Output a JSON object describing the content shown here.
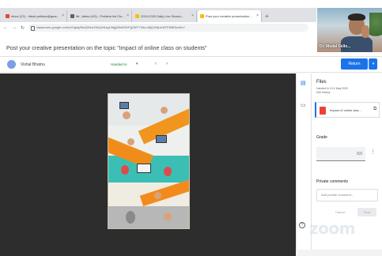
{
  "browser": {
    "tabs": [
      {
        "label": "Inbox (22) - ritesh.pethkar@gma...",
        "color": "#ea4335",
        "active": false
      },
      {
        "label": "Mr. Jakes (UD) - Problem list Clo...",
        "color": "#5f6368",
        "active": false
      },
      {
        "label": "2019-2020 Daily Live Sessio...",
        "color": "#fbbc04",
        "active": false
      },
      {
        "label": "Post your creative presentation...",
        "color": "#fbbc04",
        "active": true
      }
    ],
    "new_tab": "+",
    "url": "classroom.google.com/u/0/g/tg/MzQ0NzI1NzQxNzg1/Mjg5NzE2MTg3NTY3#u=MjQ1NjUwNTE5MDkz&t=f"
  },
  "assignment": {
    "title": "Post your creative presentation on the topic \"Impact of online class on students\"",
    "close": "×"
  },
  "video": {
    "name": "Dr. Medal Fello..."
  },
  "student_row": {
    "name": "Vishal Bhatnu",
    "status": "Handed in",
    "caret": "▾",
    "prev": "‹",
    "next": "›",
    "return_label": "Return",
    "return_caret": "▾"
  },
  "panel": {
    "files_label": "Files",
    "submitted": "Handed in 3:12 May 2020",
    "late": "See history",
    "attachment_name": "Impact of online clas...",
    "open_icon": "⧉",
    "grade_label": "Grade",
    "grade_value": "/10",
    "grade_more": "⋮",
    "private_label": "Private comments",
    "private_placeholder": "Add private comment...",
    "cancel_label": "Cancel",
    "post_label": "Post"
  },
  "sidebar_icons": [
    "file-icon",
    "comment-icon"
  ],
  "help": "?",
  "watermark": "zoom"
}
